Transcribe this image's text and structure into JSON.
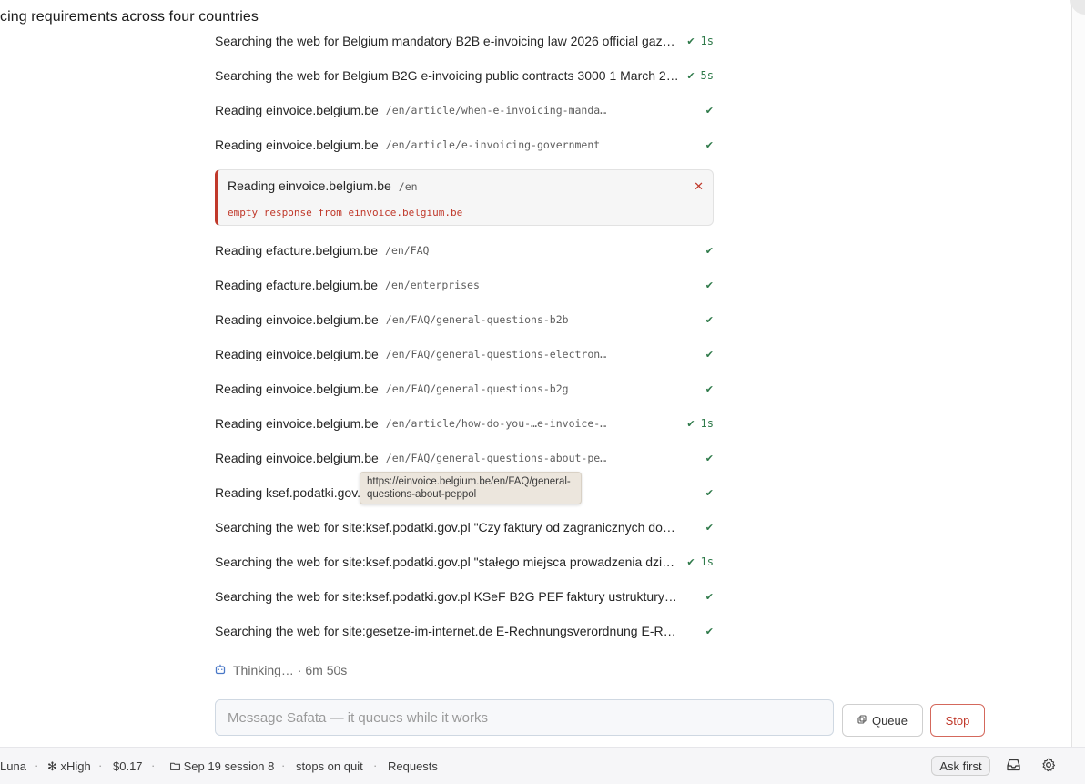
{
  "header": {
    "title": "cing requirements across four countries"
  },
  "activity": [
    {
      "kind": "search",
      "label": "Searching the web for Belgium mandatory B2B e-invoicing law 2026 official gazett…",
      "time": "1s"
    },
    {
      "kind": "search",
      "label": "Searching the web for Belgium B2G e-invoicing public contracts 3000 1 March 202…",
      "time": "5s"
    },
    {
      "kind": "read",
      "label": "Reading einvoice.belgium.be",
      "path": "/en/article/when-e-invoicing-mandat…"
    },
    {
      "kind": "read",
      "label": "Reading einvoice.belgium.be",
      "path": "/en/article/e-invoicing-government"
    },
    {
      "kind": "error",
      "label": "Reading einvoice.belgium.be",
      "path": "/en",
      "message": "empty response from einvoice.belgium.be"
    },
    {
      "kind": "read",
      "label": "Reading efacture.belgium.be",
      "path": "/en/FAQ"
    },
    {
      "kind": "read",
      "label": "Reading efacture.belgium.be",
      "path": "/en/enterprises"
    },
    {
      "kind": "read",
      "label": "Reading einvoice.belgium.be",
      "path": "/en/FAQ/general-questions-b2b"
    },
    {
      "kind": "read",
      "label": "Reading einvoice.belgium.be",
      "path": "/en/FAQ/general-questions-electroni…"
    },
    {
      "kind": "read",
      "label": "Reading einvoice.belgium.be",
      "path": "/en/FAQ/general-questions-b2g"
    },
    {
      "kind": "read",
      "label": "Reading einvoice.belgium.be",
      "path": "/en/article/how-do-you-…e-invoice-a…",
      "time": "1s"
    },
    {
      "kind": "read",
      "label": "Reading einvoice.belgium.be",
      "path": "/en/FAQ/general-questions-about-pep…"
    },
    {
      "kind": "read",
      "label": "Reading ksef.podatki.gov.p",
      "path": ""
    },
    {
      "kind": "search",
      "label": "Searching the web for site:ksef.podatki.gov.pl \"Czy faktury od zagranicznych dostawc…"
    },
    {
      "kind": "search",
      "label": "Searching the web for site:ksef.podatki.gov.pl \"stałego miejsca prowadzenia działa…",
      "time": "1s"
    },
    {
      "kind": "search",
      "label": "Searching the web for site:ksef.podatki.gov.pl KSeF B2G PEF faktury ustrukturyzowan…"
    },
    {
      "kind": "search",
      "label": "Searching the web for site:gesetze-im-internet.de E-Rechnungsverordnung E-RechV 2…"
    }
  ],
  "tooltip": {
    "text": "https://einvoice.belgium.be/en/FAQ/general-questions-about-peppol"
  },
  "thinking": {
    "icon": "robot-icon",
    "text": "Thinking… · 6m 50s"
  },
  "composer": {
    "placeholder": "Message Safata — it queues while it works",
    "queue_label": "Queue",
    "stop_label": "Stop"
  },
  "status_bar": {
    "model": "Luna",
    "effort": "xHigh",
    "cost": "$0.17",
    "session": "Sep 19 session 8",
    "quit_behavior": "stops on quit",
    "requests": "Requests",
    "permission": "Ask first"
  },
  "colors": {
    "success": "#2f7a4a",
    "error": "#c0392b",
    "accent": "#4a78c7"
  }
}
